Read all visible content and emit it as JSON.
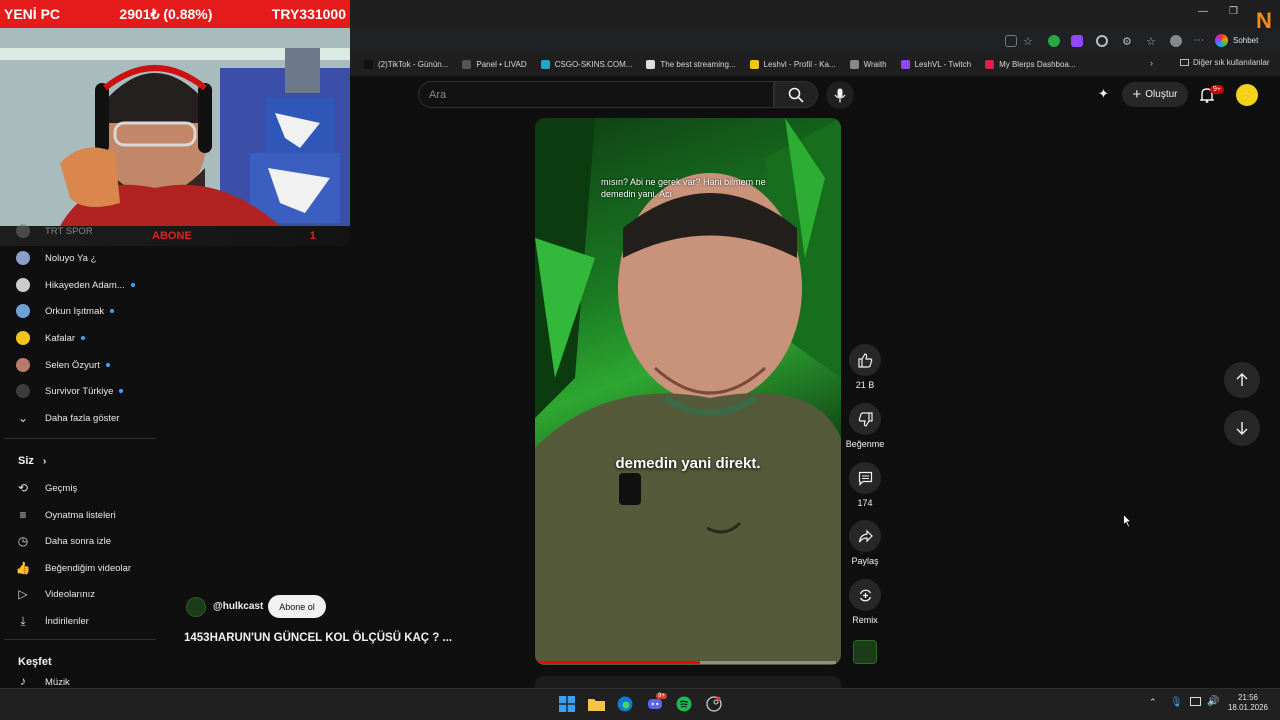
{
  "overlay": {
    "label": "YENİ PC",
    "change": "2901₺ (0.88%)",
    "total": "TRY331000",
    "abone_label": "ABONE",
    "abone_count": "1"
  },
  "browser": {
    "sohbet": "Sohbet",
    "other_bookmarks": "Diğer sık kullanılanlar",
    "bookmarks": [
      {
        "label": "(2)TikTok - Günün...",
        "color": "#111111"
      },
      {
        "label": "Panel • LIVAD",
        "color": "#555555"
      },
      {
        "label": "CSGO-SKINS.COM...",
        "color": "#2aa3c9"
      },
      {
        "label": "The best streaming...",
        "color": "#dddddd"
      },
      {
        "label": "Leshvl - Profil - Ka...",
        "color": "#f5c518"
      },
      {
        "label": "Wraith",
        "color": "#888888"
      },
      {
        "label": "LeshVL - Twitch",
        "color": "#9146ff"
      },
      {
        "label": "My Blerps Dashboa...",
        "color": "#e11d48"
      }
    ]
  },
  "header": {
    "search_placeholder": "Ara",
    "create_label": "Oluştur",
    "notifications": "9+"
  },
  "sidebar": {
    "partial_top": "TRT SPOR",
    "channels": [
      {
        "label": "Noluyo Ya ¿",
        "color": "#8aa0c8",
        "dot": false
      },
      {
        "label": "Hikayeden Adam...",
        "color": "#cccccc",
        "dot": true
      },
      {
        "label": "Orkun Işıtmak",
        "color": "#6fa0d8",
        "dot": true
      },
      {
        "label": "Kafalar",
        "color": "#f2c318",
        "dot": true
      },
      {
        "label": "Selen Özyurt",
        "color": "#b87a6a",
        "dot": true
      },
      {
        "label": "Survivor Türkiye",
        "color": "#3c3c3c",
        "dot": true
      }
    ],
    "show_more": "Daha fazla göster",
    "you_heading": "Siz",
    "you_items": [
      {
        "label": "Geçmiş",
        "icon": "history-icon"
      },
      {
        "label": "Oynatma listeleri",
        "icon": "playlists-icon"
      },
      {
        "label": "Daha sonra izle",
        "icon": "watch-later-icon"
      },
      {
        "label": "Beğendiğim videolar",
        "icon": "liked-videos-icon"
      },
      {
        "label": "Videolarınız",
        "icon": "your-videos-icon"
      },
      {
        "label": "İndirilenler",
        "icon": "downloads-icon"
      }
    ],
    "explore_heading": "Keşfet",
    "explore_partial": "Müzik"
  },
  "video": {
    "caption_top": "mısın? Abi ne gerek var? Hani bilmem ne demedin yani. Acı",
    "caption_main": "demedin yani direkt.",
    "progress": 0.54,
    "channel": "@hulkcast",
    "subscribe": "Abone ol",
    "title": "1453HARUN'UN GÜNCEL KOL ÖLÇÜSÜ KAÇ ?  ..."
  },
  "actions": {
    "likes": "21 B",
    "dislike": "Beğenme",
    "comments": "174",
    "share": "Paylaş",
    "remix": "Remix"
  },
  "taskbar": {
    "time": "21:56",
    "date": "18.01.2026",
    "discord_badge": "9+"
  }
}
